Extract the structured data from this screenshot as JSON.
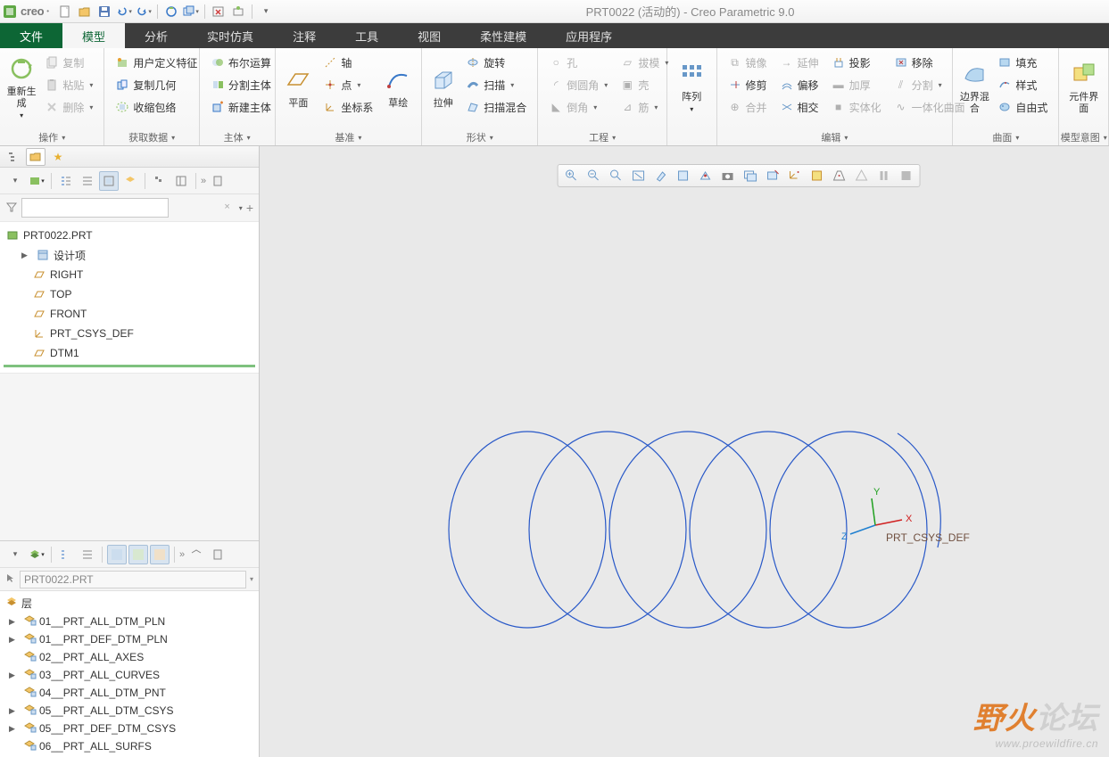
{
  "app": {
    "logo": "creo",
    "title": "PRT0022 (活动的) - Creo Parametric 9.0"
  },
  "tabs": {
    "file": "文件",
    "model": "模型",
    "analysis": "分析",
    "sim": "实时仿真",
    "annot": "注释",
    "tools": "工具",
    "view": "视图",
    "flex": "柔性建模",
    "apps": "应用程序"
  },
  "ribbon": {
    "ops": {
      "title": "操作",
      "regen": "重新生成",
      "copy": "复制",
      "paste": "粘贴",
      "delete": "删除"
    },
    "getdata": {
      "title": "获取数据",
      "udf": "用户定义特征",
      "copygeom": "复制几何",
      "shrink": "收缩包络"
    },
    "body": {
      "title": "主体",
      "bool": "布尔运算",
      "splitbody": "分割主体",
      "newbody": "新建主体"
    },
    "datum": {
      "title": "基准",
      "plane": "平面",
      "axis": "轴",
      "point": "点",
      "csys": "坐标系",
      "sketch": "草绘"
    },
    "shape": {
      "title": "形状",
      "extrude": "拉伸",
      "revolve": "旋转",
      "sweep": "扫描",
      "sweepblend": "扫描混合"
    },
    "eng": {
      "title": "工程",
      "hole": "孔",
      "round": "倒圆角",
      "chamfer": "倒角",
      "draft": "拔模",
      "shell": "壳",
      "rib": "筋"
    },
    "pattern": {
      "title": "",
      "btn": "阵列"
    },
    "edit": {
      "title": "编辑",
      "mirror": "镜像",
      "extend": "延伸",
      "project": "投影",
      "remove": "移除",
      "trim": "修剪",
      "offset": "偏移",
      "thicken": "加厚",
      "split": "分割",
      "merge": "合并",
      "intersect": "相交",
      "solidify": "实体化",
      "boundcurve": "一体化曲面"
    },
    "surf": {
      "title": "曲面",
      "blend": "边界混合",
      "fill": "填充",
      "style": "样式",
      "free": "自由式"
    },
    "intent": {
      "title": "模型意图",
      "btn": "元件界面"
    }
  },
  "tree": {
    "root": "PRT0022.PRT",
    "design": "设计项",
    "items": [
      "RIGHT",
      "TOP",
      "FRONT",
      "PRT_CSYS_DEF",
      "DTM1"
    ]
  },
  "layers": {
    "hdr": "层",
    "ro": "PRT0022.PRT",
    "items": [
      {
        "n": "01__PRT_ALL_DTM_PLN",
        "exp": true
      },
      {
        "n": "01__PRT_DEF_DTM_PLN",
        "exp": true
      },
      {
        "n": "02__PRT_ALL_AXES",
        "exp": false
      },
      {
        "n": "03__PRT_ALL_CURVES",
        "exp": true
      },
      {
        "n": "04__PRT_ALL_DTM_PNT",
        "exp": false
      },
      {
        "n": "05__PRT_ALL_DTM_CSYS",
        "exp": true
      },
      {
        "n": "05__PRT_DEF_DTM_CSYS",
        "exp": true
      },
      {
        "n": "06__PRT_ALL_SURFS",
        "exp": false
      }
    ]
  },
  "gfx": {
    "csys_label": "PRT_CSYS_DEF",
    "x": "X",
    "y": "Y",
    "z": "Z"
  },
  "watermark": {
    "name": "野火论坛",
    "url": "www.proewildfire.cn"
  }
}
